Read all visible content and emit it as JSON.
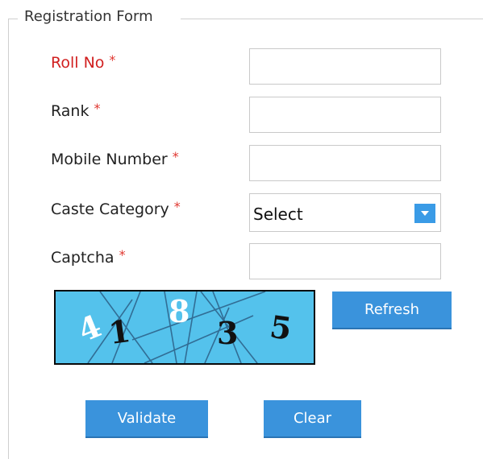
{
  "form": {
    "legend": "Registration Form",
    "required_marker": "*",
    "fields": {
      "roll_no": {
        "label": "Roll No",
        "value": ""
      },
      "rank": {
        "label": "Rank",
        "value": ""
      },
      "mobile": {
        "label": "Mobile Number",
        "value": ""
      },
      "caste": {
        "label": "Caste Category",
        "selected": "Select"
      },
      "captcha": {
        "label": "Captcha",
        "value": ""
      }
    }
  },
  "captcha_image": {
    "digits": [
      "4",
      "1",
      "8",
      "3",
      "5"
    ],
    "background_color": "#54c2ec"
  },
  "buttons": {
    "refresh": "Refresh",
    "validate": "Validate",
    "clear": "Clear"
  },
  "colors": {
    "accent": "#3a93dc",
    "required": "#e0362f",
    "highlight_label": "#d11f1f"
  }
}
